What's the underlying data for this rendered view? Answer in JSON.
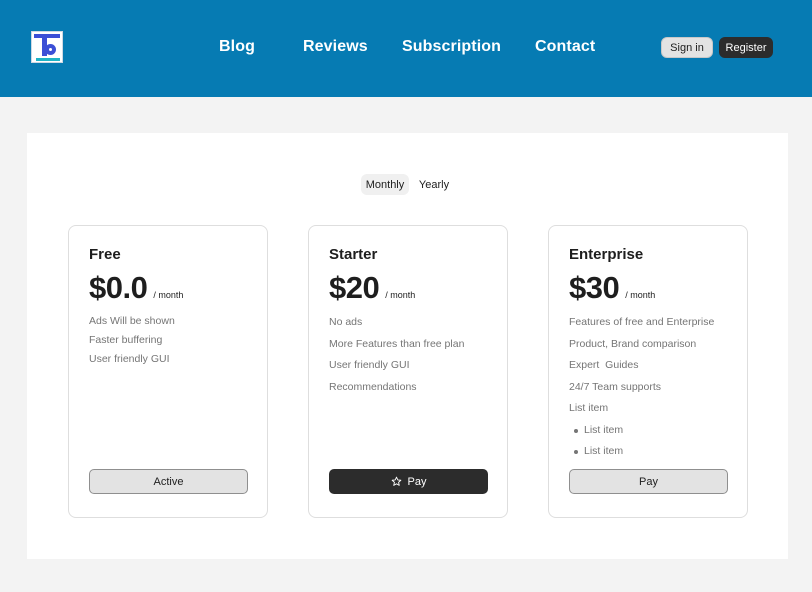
{
  "header": {
    "logo_icon": "brand-logo-icon",
    "nav": [
      "Blog",
      "Reviews",
      "Subscription",
      "Contact"
    ],
    "signin_label": "Sign in",
    "register_label": "Register",
    "bg_color": "#067bb3"
  },
  "billing_toggle": {
    "monthly_label": "Monthly",
    "yearly_label": "Yearly",
    "selected": "Monthly"
  },
  "plans": [
    {
      "title": "Free",
      "price": "$0.0",
      "period": "/ month",
      "features": [
        "Ads Will be shown",
        "Faster buffering",
        "User friendly GUI"
      ],
      "button_label": "Active"
    },
    {
      "title": "Starter",
      "price": "$20",
      "period": "/ month",
      "features": [
        "No ads",
        "More Features than free plan",
        "User friendly GUI",
        "Recommendations"
      ],
      "button_label": "Pay",
      "button_icon": "star-icon"
    },
    {
      "title": "Enterprise",
      "price": "$30",
      "period": "/ month",
      "features": [
        "Features of free and Enterprise",
        "Product, Brand comparison",
        "Expert  Guides",
        "24/7 Team supports",
        "List item"
      ],
      "sub_items": [
        "List item",
        "List item"
      ],
      "button_label": "Pay"
    }
  ]
}
